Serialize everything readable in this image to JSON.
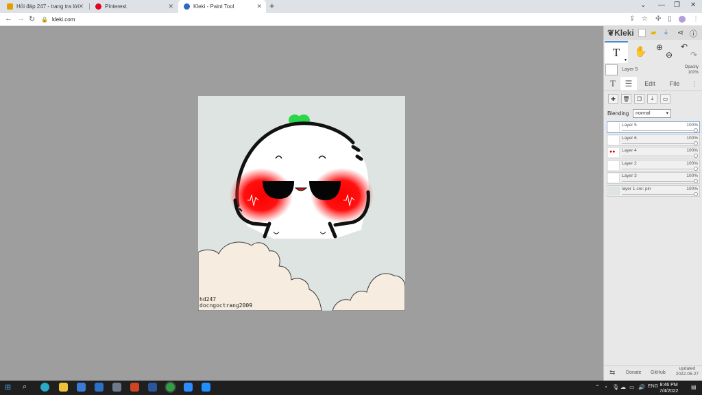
{
  "browser": {
    "tabs": [
      {
        "title": "Hỏi đáp 247 - trang tra lời",
        "color": "#e0a000"
      },
      {
        "title": "Pinterest",
        "color": "#e60023"
      },
      {
        "title": "Kleki - Paint Tool",
        "color": "#2c6bc4",
        "active": true
      }
    ],
    "new_tab": "+",
    "url": "kleki.com"
  },
  "canvas": {
    "watermark_line1": "hd247",
    "watermark_line2": "docngoctrang2009"
  },
  "app": {
    "logo": "Kleki",
    "current_tool": "T",
    "layer_info": {
      "name": "Layer 5",
      "opacity_label": "Opacity",
      "opacity_value": "100%"
    },
    "tabs": {
      "text": "T",
      "edit": "Edit",
      "file": "File",
      "more": "⋮"
    },
    "blending_label": "Blending",
    "blending_mode": "normal",
    "layers": [
      {
        "name": "Layer 5",
        "opacity": "100%",
        "selected": true
      },
      {
        "name": "Layer 6",
        "opacity": "100%"
      },
      {
        "name": "Layer 4",
        "opacity": "100%"
      },
      {
        "name": "Layer 2",
        "opacity": "100%"
      },
      {
        "name": "Layer 3",
        "opacity": "100%"
      },
      {
        "name": "layer 1 cre: pin",
        "opacity": "100%"
      }
    ],
    "footer": {
      "donate": "Donate",
      "github": "GitHub",
      "updated_label": "updated",
      "updated_date": "2022-06-27"
    }
  },
  "taskbar": {
    "language": "ENG",
    "time": "8:46 PM",
    "date": "7/4/2022"
  }
}
